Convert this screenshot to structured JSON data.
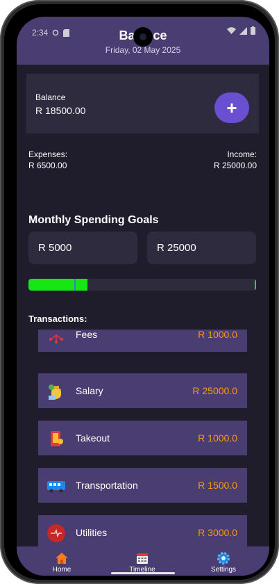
{
  "status": {
    "time": "2:34"
  },
  "header": {
    "title": "Balance",
    "date": "Friday, 02 May 2025"
  },
  "balance": {
    "label": "Balance",
    "amount": "R 18500.00",
    "add_label": "+"
  },
  "summary": {
    "expenses_label": "Expenses:",
    "expenses_value": "R 6500.00",
    "income_label": "Income:",
    "income_value": "R 25000.00"
  },
  "goals": {
    "title": "Monthly Spending Goals",
    "min_value": "R 5000",
    "max_value": "R 25000",
    "progress_fraction": 0.26,
    "min_marker_fraction": 0.2
  },
  "transactions": {
    "title": "Transactions:",
    "items": [
      {
        "name": "Fees",
        "amount": "R 1000.0",
        "icon": "fees-icon"
      },
      {
        "name": "Salary",
        "amount": "R 25000.0",
        "icon": "money-bag-icon"
      },
      {
        "name": "Takeout",
        "amount": "R 1000.0",
        "icon": "takeout-icon"
      },
      {
        "name": "Transportation",
        "amount": "R 1500.0",
        "icon": "bus-icon"
      },
      {
        "name": "Utilities",
        "amount": "R 3000.0",
        "icon": "utilities-icon"
      }
    ]
  },
  "nav": {
    "home": "Home",
    "timeline": "Timeline",
    "settings": "Settings"
  },
  "colors": {
    "accent": "#6a4fd0",
    "header": "#4a3d72",
    "amount": "#f39c12",
    "progress": "#16e516"
  }
}
